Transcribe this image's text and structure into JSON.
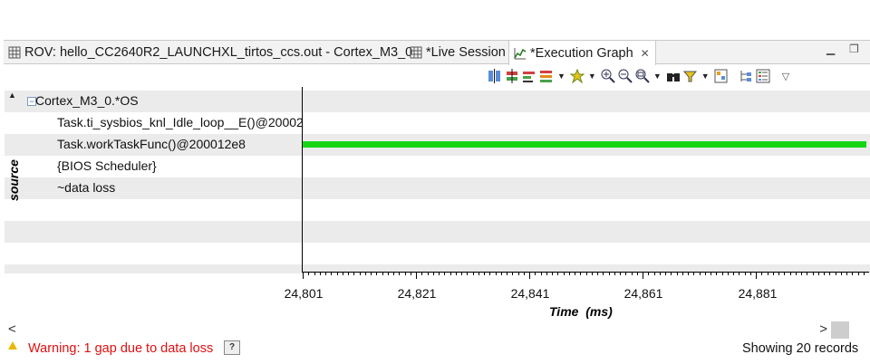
{
  "tabs": [
    {
      "label": "ROV: hello_CC2640R2_LAUNCHXL_tirtos_ccs.out - Cortex_M3_0",
      "icon": "table-icon",
      "active": false
    },
    {
      "label": "*Live Session",
      "icon": "table-icon",
      "active": false
    },
    {
      "label": "*Execution Graph",
      "icon": "graph-icon",
      "active": true
    }
  ],
  "toolbar": {
    "buttons": [
      "align-icon",
      "split-icon",
      "measure-icon",
      "bookmark-icon",
      "marker-icon",
      "zoom-in-icon",
      "zoom-out-icon",
      "zoom-fit-icon",
      "find-icon",
      "filter-icon",
      "group-icon",
      "tree-icon",
      "legend-icon",
      "view-menu-icon"
    ]
  },
  "graph": {
    "axis_label": "source",
    "root": "Cortex_M3_0.*OS",
    "rows": [
      "Task.ti_sysbios_knl_Idle_loop__E()@20002",
      "Task.workTaskFunc()@200012e8",
      "{BIOS Scheduler}",
      "~data loss"
    ],
    "active_row": "Task.workTaskFunc()@200012e8",
    "bar_color": "#15d515"
  },
  "axis": {
    "ticks": [
      "24,801",
      "24,821",
      "24,841",
      "24,861",
      "24,881"
    ],
    "label": "Time  (ms)"
  },
  "status": {
    "warning": "Warning: 1 gap due to data loss",
    "help": "?",
    "records": "Showing 20 records"
  }
}
